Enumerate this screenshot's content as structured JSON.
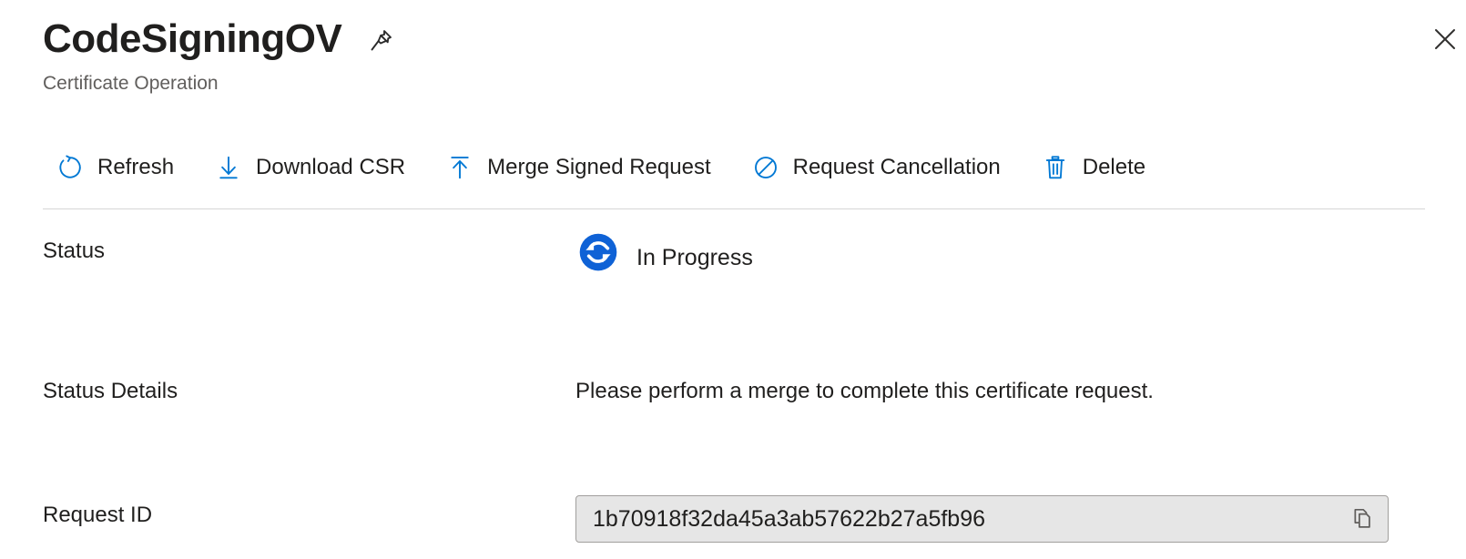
{
  "header": {
    "title": "CodeSigningOV",
    "subtitle": "Certificate Operation",
    "pin_icon": "pin-icon",
    "close_icon": "close-icon"
  },
  "colors": {
    "accent": "#0078d4",
    "text": "#201f1e",
    "subtext": "#605e5c",
    "field_bg": "#e6e6e6",
    "field_border": "#a19f9d",
    "divider": "#d6d6d6"
  },
  "command_bar": {
    "buttons": [
      {
        "label": "Refresh",
        "icon": "refresh-icon"
      },
      {
        "label": "Download CSR",
        "icon": "download-icon"
      },
      {
        "label": "Merge Signed Request",
        "icon": "upload-icon"
      },
      {
        "label": "Request Cancellation",
        "icon": "block-icon"
      },
      {
        "label": "Delete",
        "icon": "trash-icon"
      }
    ]
  },
  "properties": {
    "status": {
      "label": "Status",
      "value": "In Progress",
      "icon": "in-progress-sync-icon"
    },
    "status_details": {
      "label": "Status Details",
      "value": "Please perform a merge to complete this certificate request."
    },
    "request_id": {
      "label": "Request ID",
      "value": "1b70918f32da45a3ab57622b27a5fb96",
      "copy_icon": "copy-icon"
    }
  }
}
